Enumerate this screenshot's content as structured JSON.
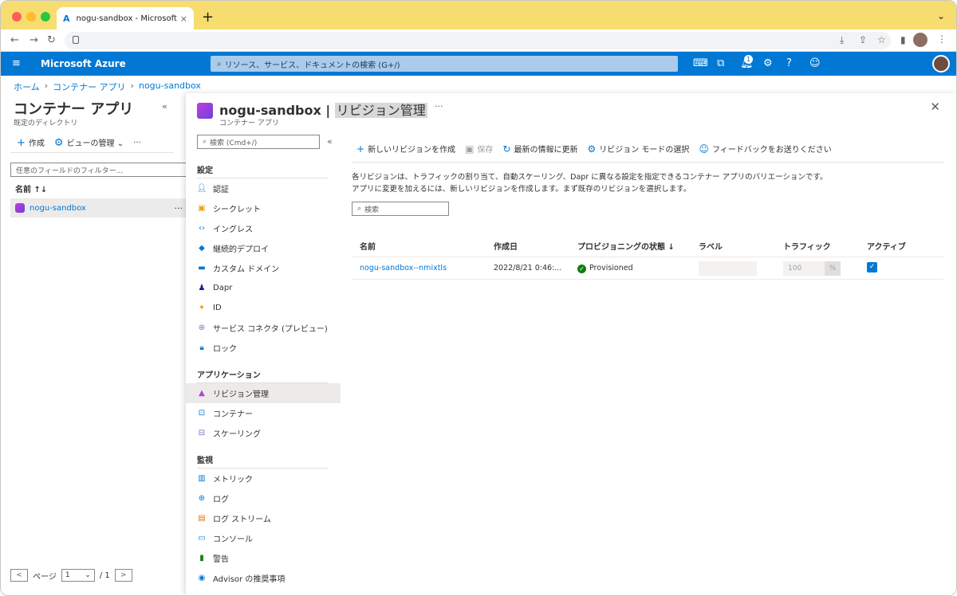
{
  "browser": {
    "tab_title": "nogu-sandbox - Microsoft Azure",
    "tab_close": "×",
    "new_tab": "+",
    "nav_back": "←",
    "nav_forward": "→",
    "nav_reload": "↻"
  },
  "azure_header": {
    "menu": "≡",
    "brand": "Microsoft Azure",
    "search_placeholder": "リソース、サービス、ドキュメントの検索 (G+/)",
    "notification_count": "1"
  },
  "breadcrumb": [
    "ホーム",
    "コンテナー アプリ",
    "nogu-sandbox"
  ],
  "left_blade": {
    "title": "コンテナー アプリ",
    "subtitle": "既定のディレクトリ",
    "collapse": "«",
    "create_label": "作成",
    "view_label": "ビューの管理",
    "more": "···",
    "filter_placeholder": "任意のフィールドのフィルター...",
    "column_name": "名前 ↑↓",
    "rows": [
      {
        "name": "nogu-sandbox"
      }
    ],
    "row_more": "···",
    "pager": {
      "page_label": "ページ",
      "current": "1",
      "of": "/ 1",
      "prev": "<",
      "next": ">"
    }
  },
  "main_blade": {
    "title_resource": "nogu-sandbox",
    "title_sep": " | ",
    "title_page": "リビジョン管理",
    "subtitle": "コンテナー アプリ",
    "more": "···",
    "close": "✕"
  },
  "resource_menu": {
    "search_placeholder": "検索 (Cmd+/)",
    "collapse": "«",
    "sections": [
      {
        "title": "設定",
        "items": [
          "認証",
          "シークレット",
          "イングレス",
          "継続的デプロイ",
          "カスタム ドメイン",
          "Dapr",
          "ID",
          "サービス コネクタ (プレビュー)",
          "ロック"
        ]
      },
      {
        "title": "アプリケーション",
        "items": [
          "リビジョン管理",
          "コンテナー",
          "スケーリング"
        ]
      },
      {
        "title": "監視",
        "items": [
          "メトリック",
          "ログ",
          "ログ ストリーム",
          "コンソール",
          "警告",
          "Advisor の推奨事項"
        ]
      }
    ]
  },
  "commands": {
    "new_revision": "新しいリビジョンを作成",
    "save": "保存",
    "refresh": "最新の情報に更新",
    "revision_mode": "リビジョン モードの選択",
    "feedback": "フィードバックをお送りください"
  },
  "description": {
    "line1": "各リビジョンは、トラフィックの割り当て、自動スケーリング、Dapr に異なる設定を指定できるコンテナー アプリのバリエーションです。",
    "line2": "アプリに変更を加えるには、新しいリビジョンを作成します。まず既存のリビジョンを選択します。"
  },
  "table": {
    "search_placeholder": "検索",
    "columns": [
      "名前",
      "作成日",
      "プロビジョニングの状態 ↓",
      "ラベル",
      "トラフィック",
      "アクティブ"
    ],
    "rows": [
      {
        "name": "nogu-sandbox--nmixtls",
        "created": "2022/8/21 0:46:...",
        "state": "Provisioned",
        "label": "",
        "traffic": "100",
        "traffic_unit": "%",
        "active": true
      }
    ]
  }
}
